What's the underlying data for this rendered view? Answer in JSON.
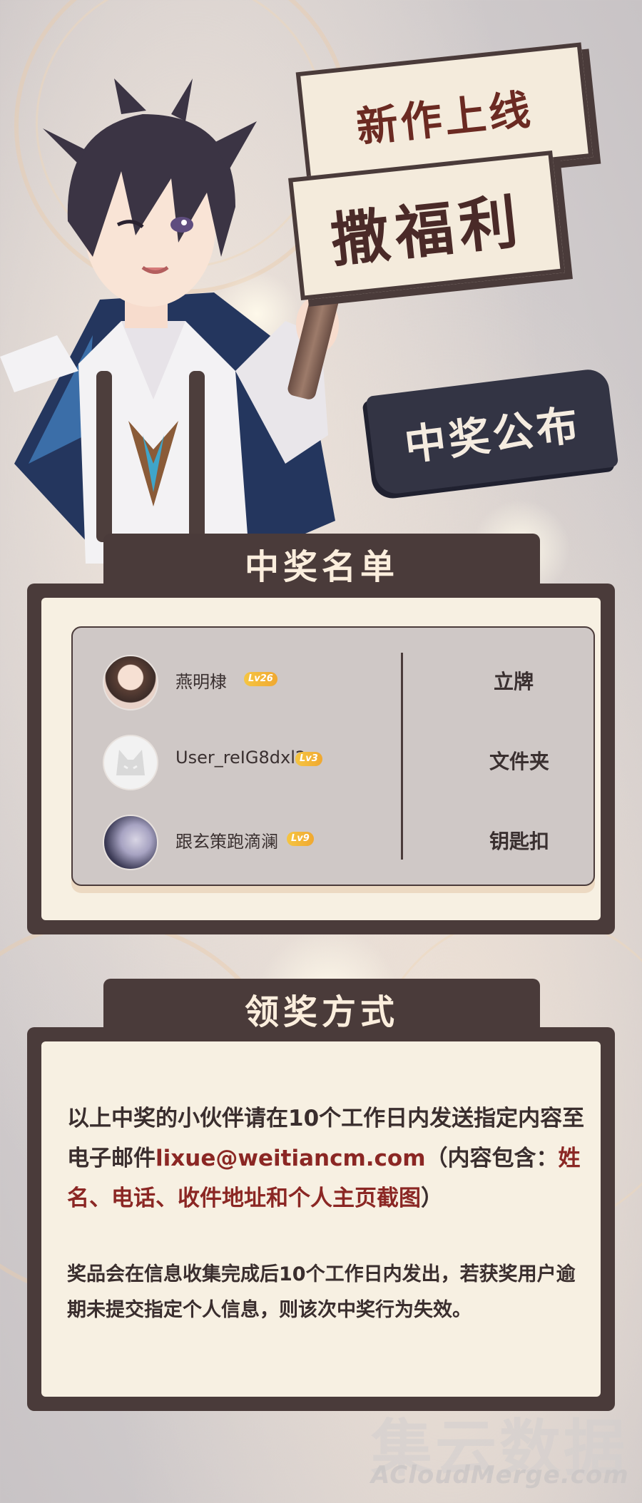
{
  "banner": {
    "line1": "新作上线",
    "line2": "撒福利",
    "announce": "中奖公布"
  },
  "winners_section": {
    "title": "中奖名单",
    "winners": [
      {
        "name": "燕明棣",
        "level": "Lv26",
        "prize": "立牌"
      },
      {
        "name": "User_reIG8dxl2",
        "level": "Lv3",
        "prize": "文件夹"
      },
      {
        "name": "跟玄策跑滴澜",
        "level": "Lv9",
        "prize": "钥匙扣"
      }
    ]
  },
  "claim_section": {
    "title": "领奖方式",
    "para1_a": "以上中奖的小伙伴请在10个工作日内发送指定内容至电子邮件",
    "email": "lixue@weitiancm.com",
    "para1_b": "（内容包含：",
    "para1_red": "姓名、电话、收件地址和个人主页截图",
    "para1_c": "）",
    "para2": "奖品会在信息收集完成后10个工作日内发出，若获奖用户逾期未提交指定个人信息，则该次中奖行为失效。"
  },
  "watermark": {
    "cn": "集云数据",
    "en": "ACloudMerge.com"
  },
  "colors": {
    "dark_brown": "#4a3b3a",
    "cream": "#f7f0e2",
    "red_text": "#8b2724",
    "navy_tag": "#333444",
    "level_gold": "#f0a830"
  }
}
